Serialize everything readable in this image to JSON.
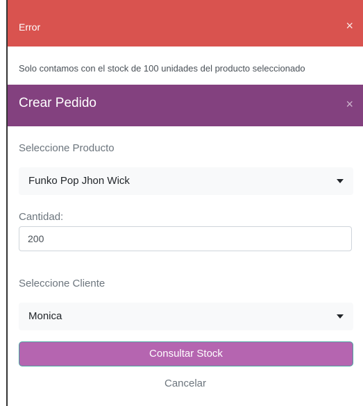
{
  "error_modal": {
    "title": "Error",
    "close_symbol": "×",
    "message": "Solo contamos con el stock de 100 unidades del producto seleccionado",
    "header_color": "#d9534f"
  },
  "order_modal": {
    "title": "Crear Pedido",
    "close_symbol": "×",
    "header_color": "#83417f",
    "product": {
      "label": "Seleccione Producto",
      "selected": "Funko Pop Jhon Wick"
    },
    "quantity": {
      "label": "Cantidad:",
      "value": "200"
    },
    "client": {
      "label": "Seleccione Cliente",
      "selected": "Monica"
    },
    "primary_button": "Consultar Stock",
    "cancel_link": "Cancelar",
    "button_color": "#b565b0"
  }
}
